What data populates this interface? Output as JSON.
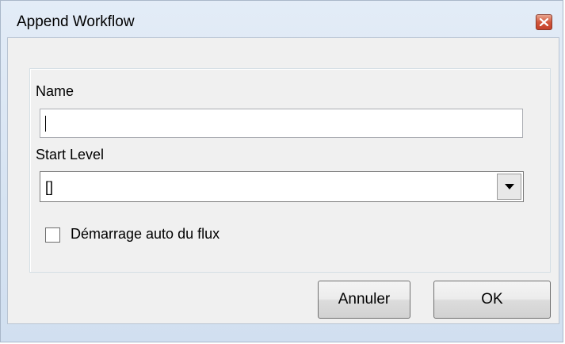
{
  "window": {
    "title": "Append Workflow"
  },
  "form": {
    "name_label": "Name",
    "name_value": "",
    "start_level_label": "Start Level",
    "start_level_value": "[]",
    "auto_start_label": "Démarrage auto du flux",
    "auto_start_checked": false
  },
  "buttons": {
    "cancel_label": "Annuler",
    "ok_label": "OK"
  },
  "icons": {
    "close": "close-icon",
    "dropdown": "chevron-down-icon"
  },
  "colors": {
    "close_button": "#d2563b",
    "frame": "#d6e3f2"
  }
}
